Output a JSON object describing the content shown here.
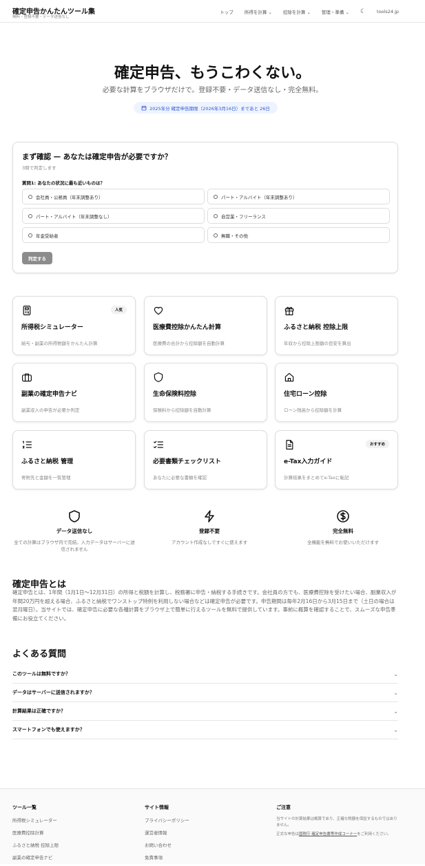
{
  "header": {
    "title": "確定申告かんたんツール集",
    "subtitle": "無料・登録不要・データ送信なし",
    "nav": [
      "トップ",
      "所得を計算",
      "控除を計算",
      "管理・準備"
    ],
    "domain": "tools24.jp"
  },
  "hero": {
    "title": "確定申告、もうこわくない。",
    "subtitle": "必要な計算をブラウザだけで。登録不要・データ送信なし・完全無料。",
    "badge": "2025年分 確定申告期限（2026年3月16日）まであと 26日"
  },
  "quiz": {
    "title": "まず確認 — あなたは確定申告が必要ですか？",
    "subtitle": "3問で判定します",
    "question": "質問1: あなたの状況に最も近いものは？",
    "options": [
      "会社員・公務員（年末調整あり）",
      "パート・アルバイト（年末調整あり）",
      "パート・アルバイト（年末調整なし）",
      "自営業・フリーランス",
      "年金受給者",
      "無職・その他"
    ],
    "submit": "判定する"
  },
  "tools": [
    {
      "title": "所得税シミュレーター",
      "desc": "給与・副業の所得税額をかんたん計算",
      "tag": "人気",
      "icon": "calculator-icon"
    },
    {
      "title": "医療費控除かんたん計算",
      "desc": "医療費の合計から控除額を自動計算",
      "icon": "heart-icon"
    },
    {
      "title": "ふるさと納税 控除上限",
      "desc": "年収から控除上限額の目安を算出",
      "icon": "gift-icon"
    },
    {
      "title": "副業の確定申告ナビ",
      "desc": "副業収入の申告が必要か判定",
      "icon": "briefcase-icon"
    },
    {
      "title": "生命保険料控除",
      "desc": "保険料から控除額を自動計算",
      "icon": "shield-icon"
    },
    {
      "title": "住宅ローン控除",
      "desc": "ローン残高から控除額を計算",
      "icon": "home-icon"
    },
    {
      "title": "ふるさと納税 管理",
      "desc": "寄附先と金額を一覧管理",
      "icon": "list-ordered-icon"
    },
    {
      "title": "必要書類チェックリスト",
      "desc": "あなたに必要な書類を確認",
      "icon": "list-checks-icon"
    },
    {
      "title": "e-Tax入力ガイド",
      "desc": "計算結果をまとめてe-Taxに転記",
      "tag": "おすすめ",
      "icon": "file-text-icon"
    }
  ],
  "features": [
    {
      "title": "データ送信なし",
      "desc": "全ての計算はブラウザ内で完結。入力データはサーバーに送信されません"
    },
    {
      "title": "登録不要",
      "desc": "アカウント作成なしですぐに使えます"
    },
    {
      "title": "完全無料",
      "desc": "全機能を無料でお使いいただけます"
    }
  ],
  "about": {
    "title": "確定申告とは",
    "body": "確定申告とは、1年間（1月1日〜12月31日）の所得と税額を計算し、税務署に申告・納税する手続きです。会社員の方でも、医療費控除を受けたい場合、副業収入が年間20万円を超える場合、ふるさと納税でワンストップ特例を利用しない場合などは確定申告が必要です。申告期間は毎年2月16日から3月15日まで（土日の場合は翌月曜日）。当サイトでは、確定申告に必要な各種計算をブラウザ上で簡単に行えるツールを無料で提供しています。事前に概算を確認することで、スムーズな申告準備にお役立てください。"
  },
  "faq": {
    "title": "よくある質問",
    "items": [
      "このツールは無料ですか？",
      "データはサーバーに送信されますか？",
      "計算結果は正確ですか？",
      "スマートフォンでも使えますか？"
    ]
  },
  "footer": {
    "tools": {
      "title": "ツール一覧",
      "links": [
        "所得税シミュレーター",
        "医療費控除計算",
        "ふるさと納税 控除上限",
        "副業の確定申告ナビ"
      ]
    },
    "site": {
      "title": "サイト情報",
      "links": [
        "プライバシーポリシー",
        "運営者情報",
        "お問い合わせ",
        "免責事項"
      ]
    },
    "notice": {
      "title": "ご注意",
      "text1": "当サイトの計算結果は概算であり、正確な税額を保証するものではありません。",
      "text2_pre": "正式な申告は",
      "link": "国税庁 確定申告書等作成コーナー",
      "text2_post": "をご利用ください。"
    }
  }
}
